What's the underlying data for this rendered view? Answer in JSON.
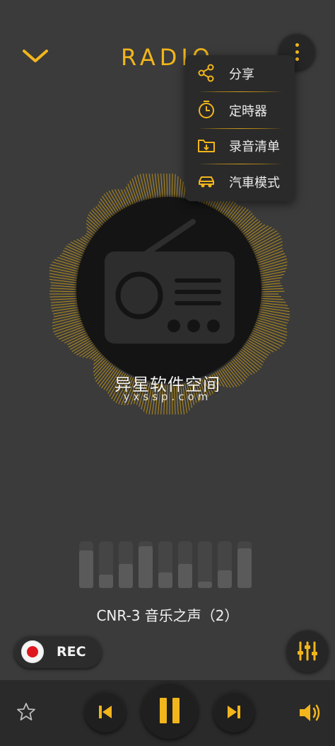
{
  "header": {
    "title": "RADIO",
    "back_icon": "chevron-down-icon",
    "more_icon": "more-vertical-icon"
  },
  "menu": {
    "items": [
      {
        "label": "分享",
        "icon": "share-icon"
      },
      {
        "label": "定時器",
        "icon": "timer-icon"
      },
      {
        "label": "录音清单",
        "icon": "folder-download-icon"
      },
      {
        "label": "汽車模式",
        "icon": "car-icon"
      }
    ]
  },
  "watermark": {
    "line1": "异星软件空间",
    "line2": "yxssp.com"
  },
  "player": {
    "station": "CNR-3 音乐之声（2）",
    "rec_label": "REC",
    "level_bars": [
      0.85,
      0.3,
      0.55,
      0.95,
      0.35,
      0.55,
      0.15,
      0.4,
      0.9
    ]
  },
  "colors": {
    "accent": "#f2b51c",
    "background": "#3b3b3b",
    "panel": "#2a2a2a",
    "record_red": "#e0161e"
  }
}
